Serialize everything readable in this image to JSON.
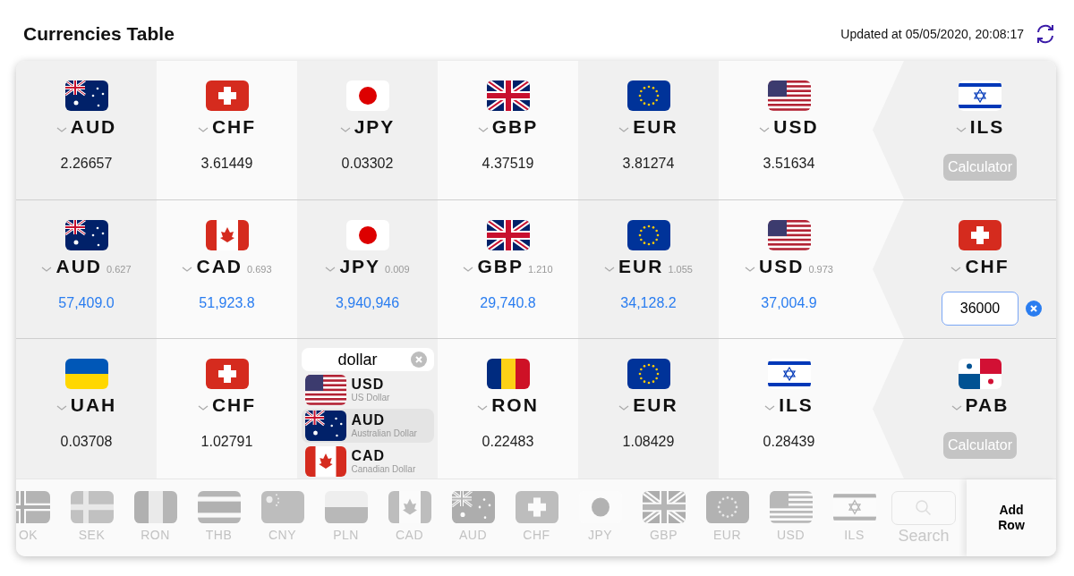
{
  "header": {
    "title": "Currencies Table",
    "updated": "Updated at 05/05/2020, 20:08:17"
  },
  "rows": [
    {
      "converted": false,
      "cells": [
        {
          "kind": "currency",
          "code": "AUD",
          "flag": {
            "kind": "au"
          },
          "value": "2.26657"
        },
        {
          "kind": "currency",
          "code": "CHF",
          "flag": {
            "kind": "ch"
          },
          "value": "3.61449"
        },
        {
          "kind": "currency",
          "code": "JPY",
          "flag": {
            "kind": "jp"
          },
          "value": "0.03302"
        },
        {
          "kind": "currency",
          "code": "GBP",
          "flag": {
            "kind": "gb"
          },
          "value": "4.37519"
        },
        {
          "kind": "currency",
          "code": "EUR",
          "flag": {
            "kind": "eu"
          },
          "value": "3.81274"
        },
        {
          "kind": "currency",
          "code": "USD",
          "flag": {
            "kind": "us"
          },
          "value": "3.51634"
        }
      ],
      "base": {
        "kind": "calculator",
        "code": "ILS",
        "flag": {
          "kind": "il"
        },
        "label": "Calculator"
      }
    },
    {
      "converted": true,
      "cells": [
        {
          "kind": "currency",
          "code": "AUD",
          "flag": {
            "kind": "au"
          },
          "rate": "0.627",
          "value": "57,409.0"
        },
        {
          "kind": "currency",
          "code": "CAD",
          "flag": {
            "kind": "ca"
          },
          "rate": "0.693",
          "value": "51,923.8"
        },
        {
          "kind": "currency",
          "code": "JPY",
          "flag": {
            "kind": "jp"
          },
          "rate": "0.009",
          "value": "3,940,946"
        },
        {
          "kind": "currency",
          "code": "GBP",
          "flag": {
            "kind": "gb"
          },
          "rate": "1.210",
          "value": "29,740.8"
        },
        {
          "kind": "currency",
          "code": "EUR",
          "flag": {
            "kind": "eu"
          },
          "rate": "1.055",
          "value": "34,128.2"
        },
        {
          "kind": "currency",
          "code": "USD",
          "flag": {
            "kind": "us"
          },
          "rate": "0.973",
          "value": "37,004.9"
        }
      ],
      "base": {
        "kind": "input",
        "code": "CHF",
        "flag": {
          "kind": "ch"
        },
        "value": "36000"
      }
    },
    {
      "converted": false,
      "cells": [
        {
          "kind": "currency",
          "code": "UAH",
          "flag": {
            "kind": "ua"
          },
          "value": "0.03708"
        },
        {
          "kind": "currency",
          "code": "CHF",
          "flag": {
            "kind": "ch"
          },
          "value": "1.02791"
        },
        {
          "kind": "picker",
          "search": {
            "value": "dollar"
          },
          "options": [
            {
              "code": "USD",
              "name": "US Dollar",
              "flag": {
                "kind": "us"
              },
              "selected": false
            },
            {
              "code": "AUD",
              "name": "Australian Dollar",
              "flag": {
                "kind": "au"
              },
              "selected": true
            },
            {
              "code": "CAD",
              "name": "Canadian Dollar",
              "flag": {
                "kind": "ca"
              },
              "selected": false
            }
          ]
        },
        {
          "kind": "currency",
          "code": "RON",
          "flag": {
            "kind": "ro"
          },
          "value": "0.22483"
        },
        {
          "kind": "currency",
          "code": "EUR",
          "flag": {
            "kind": "eu"
          },
          "value": "1.08429"
        },
        {
          "kind": "currency",
          "code": "ILS",
          "flag": {
            "kind": "il"
          },
          "value": "0.28439"
        }
      ],
      "base": {
        "kind": "calculator",
        "code": "PAB",
        "flag": {
          "kind": "pa"
        },
        "label": "Calculator"
      }
    }
  ],
  "currency_bar": {
    "items": [
      {
        "code": "OK",
        "flag": {
          "kind": "no"
        }
      },
      {
        "code": "SEK",
        "flag": {
          "kind": "se"
        }
      },
      {
        "code": "RON",
        "flag": {
          "kind": "ro"
        }
      },
      {
        "code": "THB",
        "flag": {
          "kind": "th"
        }
      },
      {
        "code": "CNY",
        "flag": {
          "kind": "cn"
        }
      },
      {
        "code": "PLN",
        "flag": {
          "kind": "pl"
        }
      },
      {
        "code": "CAD",
        "flag": {
          "kind": "ca"
        }
      },
      {
        "code": "AUD",
        "flag": {
          "kind": "au"
        }
      },
      {
        "code": "CHF",
        "flag": {
          "kind": "ch"
        }
      },
      {
        "code": "JPY",
        "flag": {
          "kind": "jp"
        }
      },
      {
        "code": "GBP",
        "flag": {
          "kind": "gb"
        }
      },
      {
        "code": "EUR",
        "flag": {
          "kind": "eu"
        }
      },
      {
        "code": "USD",
        "flag": {
          "kind": "us"
        }
      },
      {
        "code": "ILS",
        "flag": {
          "kind": "il"
        }
      }
    ],
    "search": {
      "label": "Search"
    },
    "add_row": "Add Row"
  }
}
